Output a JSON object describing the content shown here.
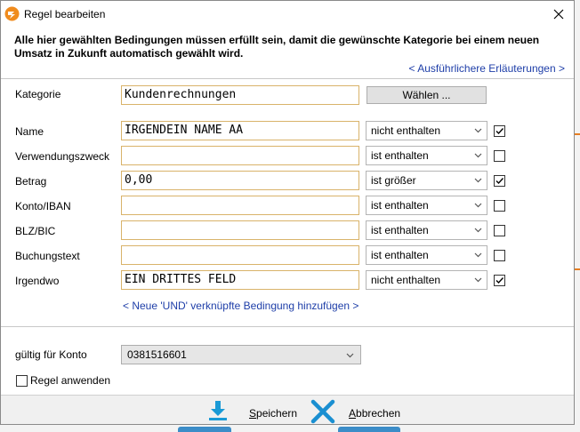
{
  "window": {
    "title": "Regel bearbeiten"
  },
  "header": {
    "description": "Alle hier gewählten Bedingungen müssen erfüllt sein, damit die gewünschte Kategorie bei einem neuen Umsatz in Zukunft automatisch gewählt wird.",
    "more_link": "< Ausführlichere Erläuterungen >"
  },
  "category": {
    "label": "Kategorie",
    "value": "Kundenrechnungen",
    "choose_button": "Wählen ..."
  },
  "conditions": [
    {
      "label": "Name",
      "value": "IRGENDEIN NAME AA",
      "operator": "nicht enthalten",
      "checked": true
    },
    {
      "label": "Verwendungszweck",
      "value": "",
      "operator": "ist enthalten",
      "checked": false
    },
    {
      "label": "Betrag",
      "value": "0,00",
      "operator": "ist größer",
      "checked": true
    },
    {
      "label": "Konto/IBAN",
      "value": "",
      "operator": "ist enthalten",
      "checked": false
    },
    {
      "label": "BLZ/BIC",
      "value": "",
      "operator": "ist enthalten",
      "checked": false
    },
    {
      "label": "Buchungstext",
      "value": "",
      "operator": "ist enthalten",
      "checked": false
    },
    {
      "label": "Irgendwo",
      "value": "EIN DRITTES FELD",
      "operator": "nicht enthalten",
      "checked": true
    }
  ],
  "add_condition_link": "< Neue 'UND' verknüpfte Bedingung hinzufügen >",
  "account": {
    "label": "gültig für Konto",
    "value": "0381516601"
  },
  "apply_rule": {
    "label": "Regel anwenden",
    "checked": false
  },
  "footer": {
    "save_label": "Speichern",
    "cancel_label": "Abbrechen"
  },
  "colors": {
    "accent_field_border": "#d9b36a",
    "link": "#1e3ea8",
    "save_icon": "#1a9ad6",
    "cancel_icon": "#1a8fd1",
    "app_icon_orange": "#f08c1e"
  },
  "icons": {
    "app": "app-logo-icon",
    "close": "close-icon",
    "chevron": "chevron-down-icon",
    "check": "check-icon",
    "save": "download-save-icon",
    "cancel": "x-cancel-icon"
  }
}
